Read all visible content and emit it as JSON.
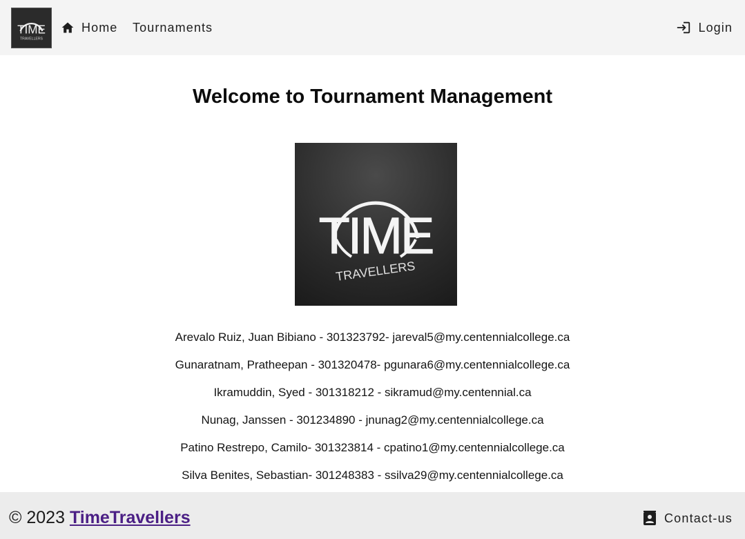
{
  "nav": {
    "home_label": "Home",
    "tournaments_label": "Tournaments",
    "login_label": "Login",
    "logo_icon": "time-travellers-logo",
    "home_icon": "home-icon",
    "login_icon": "login-icon"
  },
  "main": {
    "title": "Welcome to Tournament Management",
    "members": [
      "Arevalo Ruiz, Juan Bibiano - 301323792- jareval5@my.centennialcollege.ca",
      "Gunaratnam, Pratheepan - 301320478- pgunara6@my.centennialcollege.ca",
      "Ikramuddin, Syed - 301318212 - sikramud@my.centennial.ca",
      "Nunag, Janssen - 301234890 - jnunag2@my.centennialcollege.ca",
      "Patino Restrepo, Camilo- 301323814 - cpatino1@my.centennialcollege.ca",
      "Silva Benites, Sebastian- 301248383 - ssilva29@my.centennialcollege.ca"
    ]
  },
  "footer": {
    "copyright_prefix": "© 2023 ",
    "brand_link": "TimeTravellers",
    "contact_label": "Contact-us",
    "contact_icon": "contact-card-icon"
  },
  "logo_text": {
    "main": "TIME",
    "sub": "TRAVELLERS"
  },
  "colors": {
    "navbar_bg": "#f4f4f4",
    "footer_bg": "#ececec",
    "brand_link": "#4b1f85",
    "logo_bg": "#2a2a2a"
  }
}
